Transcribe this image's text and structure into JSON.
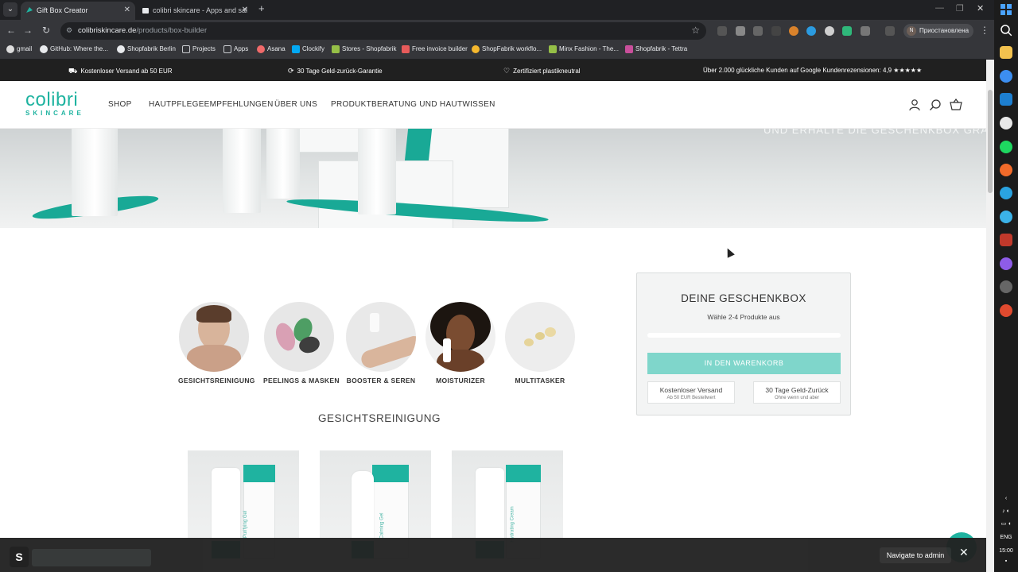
{
  "browser": {
    "tabs": [
      {
        "title": "Gift Box Creator",
        "active": true
      },
      {
        "title": "colibri skincare - Apps and sal",
        "active": false
      }
    ],
    "url_host": "colibriskincare.de",
    "url_path": "/products/box-builder",
    "profile_label": "Приостановлена",
    "profile_initial": "N",
    "bookmarks": [
      "gmail",
      "GitHub: Where the...",
      "Shopfabrik Berlin",
      "Projects",
      "Apps",
      "Asana",
      "Clockify",
      "Stores - Shopfabrik",
      "Free invoice builder",
      "ShopFabrik workflo...",
      "Minx Fashion - The...",
      "Shopfabrik - Tettra"
    ]
  },
  "announcement": [
    "Kostenloser Versand ab 50 EUR",
    "30 Tage Geld-zurück-Garantie",
    "Zertifiziert plastikneutral",
    "Über 2.000 glückliche Kunden auf Google Kundenrezensionen: 4,9 ★★★★★"
  ],
  "header": {
    "logo_line1": "colibri",
    "logo_line2": "SKINCARE",
    "menu": [
      "SHOP",
      "HAUTPFLEGEEMPFEHLUNGEN",
      "ÜBER UNS",
      "PRODUKTBERATUNG UND HAUTWISSEN"
    ]
  },
  "hero": {
    "tagline": "UND ERHALTE DIE GESCHENKBOX GRATIS"
  },
  "categories": [
    "GESICHTSREINIGUNG",
    "PEELINGS & MASKEN",
    "BOOSTER & SEREN",
    "MOISTURIZER",
    "MULTITASKER"
  ],
  "section_title": "GESICHTSREINIGUNG",
  "products": [
    {
      "label": "Purifying Gel"
    },
    {
      "label": "Calming Gel"
    },
    {
      "label": "Hydrating Cream"
    }
  ],
  "giftbox": {
    "title": "DEINE GESCHENKBOX",
    "subtitle": "Wähle 2-4 Produkte aus",
    "progress": 0,
    "cta": "IN DEN WARENKORB",
    "perks": [
      {
        "title": "Kostenloser Versand",
        "sub": "Ab 50 EUR Bestellwert"
      },
      {
        "title": "30 Tage Geld-Zurück",
        "sub": "Ohne wenn und aber"
      }
    ]
  },
  "admin": {
    "navigate": "Navigate to admin"
  },
  "taskbar": {
    "lang": "ENG",
    "time": "15:00"
  }
}
